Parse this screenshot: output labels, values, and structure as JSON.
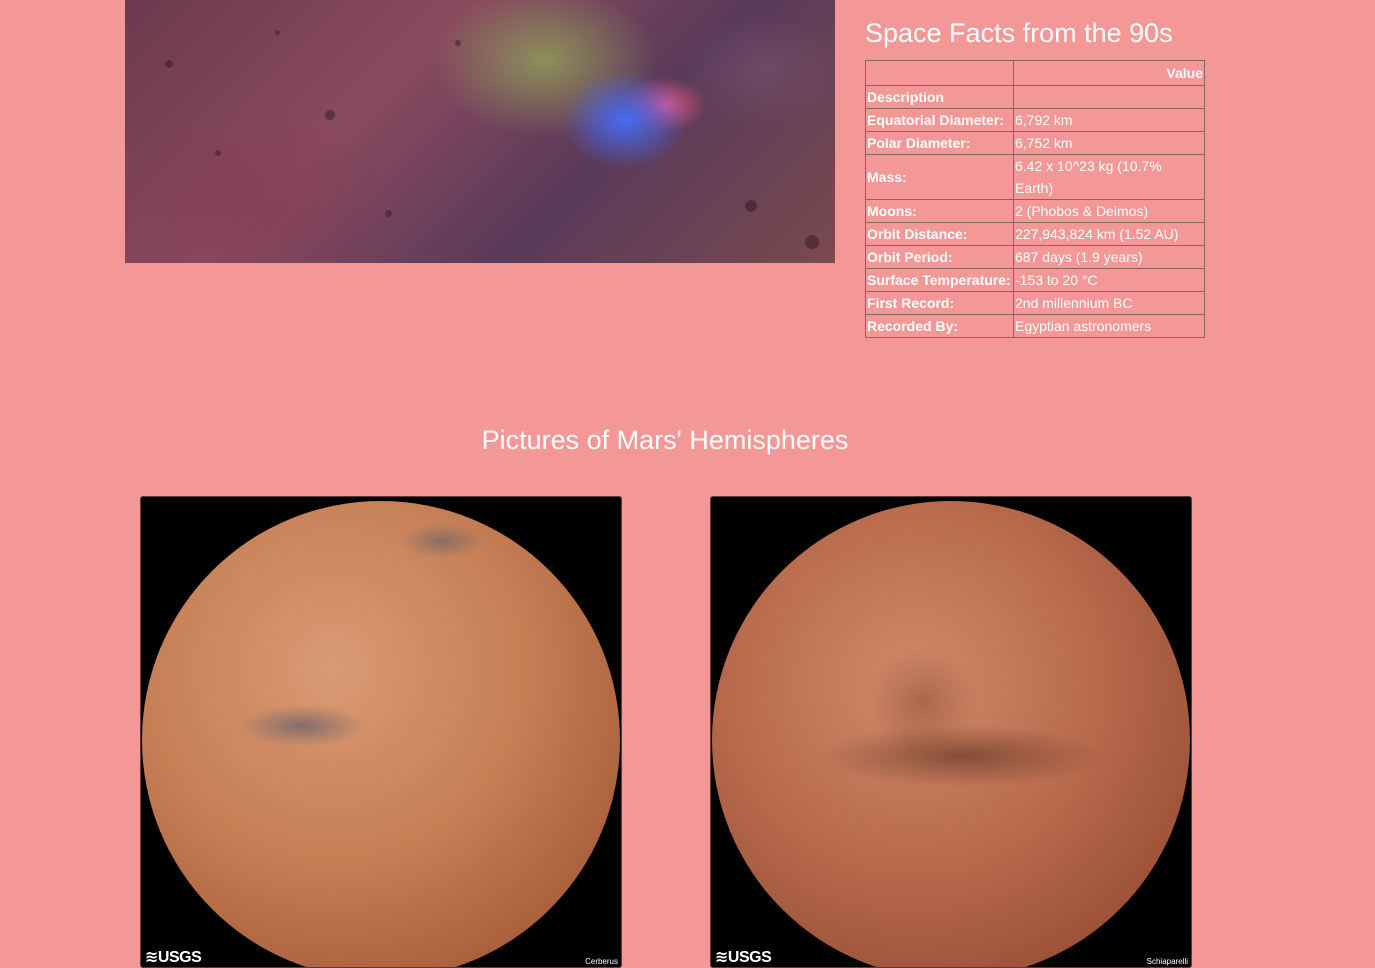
{
  "facts": {
    "title": "Space Facts from the 90s",
    "header_value": "Value",
    "rows": [
      {
        "label": "Description",
        "value": ""
      },
      {
        "label": "Equatorial Diameter:",
        "value": "6,792 km"
      },
      {
        "label": "Polar Diameter:",
        "value": "6,752 km"
      },
      {
        "label": "Mass:",
        "value": "6.42 x 10^23 kg (10.7% Earth)"
      },
      {
        "label": "Moons:",
        "value": "2 (Phobos & Deimos)"
      },
      {
        "label": "Orbit Distance:",
        "value": "227,943,824 km (1.52 AU)"
      },
      {
        "label": "Orbit Period:",
        "value": "687 days (1.9 years)"
      },
      {
        "label": "Surface Temperature:",
        "value": "-153 to 20 °C"
      },
      {
        "label": "First Record:",
        "value": "2nd millennium BC"
      },
      {
        "label": "Recorded By:",
        "value": "Egyptian astronomers"
      }
    ]
  },
  "hemispheres": {
    "title": "Pictures of Mars' Hemispheres",
    "items": [
      {
        "logo": "≋USGS",
        "name": "Cerberus"
      },
      {
        "logo": "≋USGS",
        "name": "Schiaparelli"
      }
    ]
  }
}
